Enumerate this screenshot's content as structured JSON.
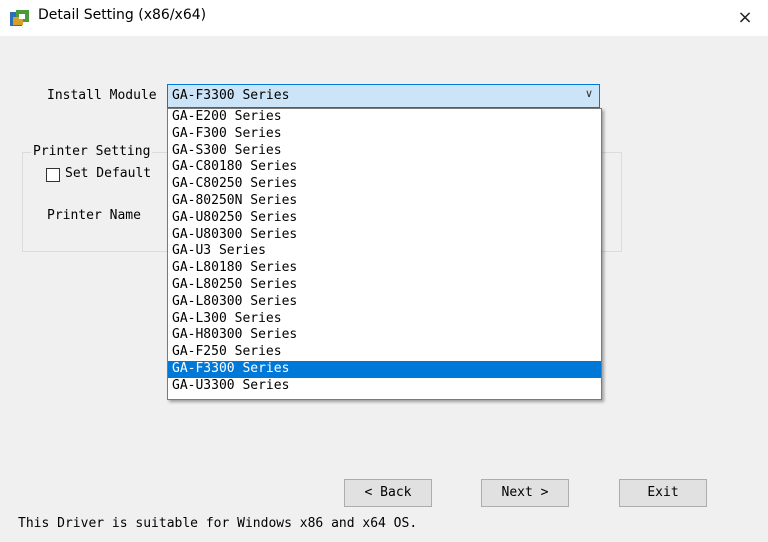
{
  "window": {
    "title": "Detail Setting (x86/x64)",
    "close_glyph": "×"
  },
  "install_module": {
    "label": "Install Module",
    "selected_value": "GA-F3300 Series",
    "options": [
      "GA-E200 Series",
      "GA-F300 Series",
      "GA-S300 Series",
      "GA-C80180 Series",
      "GA-C80250 Series",
      "GA-80250N Series",
      "GA-U80250 Series",
      "GA-U80300 Series",
      "GA-U3 Series",
      "GA-L80180 Series",
      "GA-L80250 Series",
      "GA-L80300 Series",
      "GA-L300 Series",
      "GA-H80300 Series",
      "GA-F250 Series",
      "GA-F3300 Series",
      "GA-U3300 Series"
    ],
    "highlighted_index": 15
  },
  "printer_setting": {
    "group_title": "Printer Setting",
    "set_default_label": "Set Default",
    "set_default_checked": false,
    "printer_name_label": "Printer Name"
  },
  "buttons": {
    "back": "< Back",
    "next": "Next >",
    "exit": "Exit"
  },
  "footer": "This Driver is suitable for Windows x86 and x64 OS.",
  "colors": {
    "selection": "#0078d7",
    "combo_bg": "#cce4f7",
    "dialog_bg": "#f0f0f0"
  }
}
